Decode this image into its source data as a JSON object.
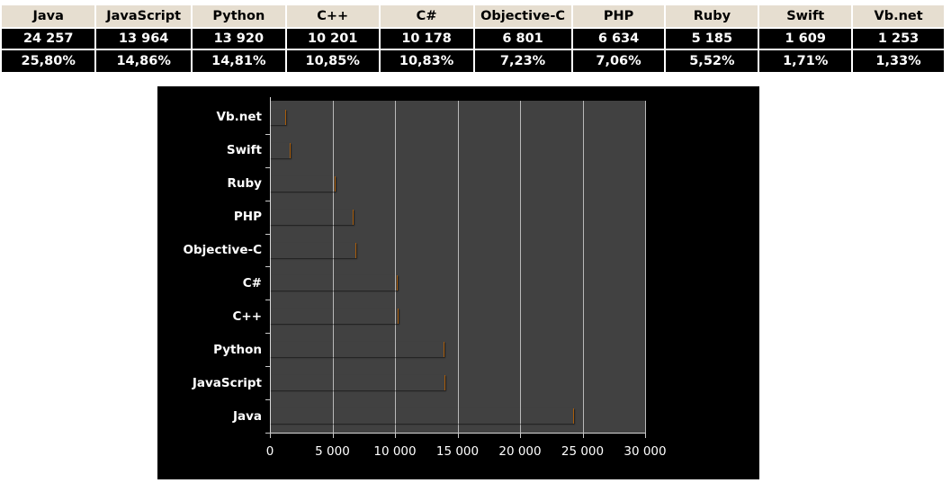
{
  "table": {
    "headers": [
      "Java",
      "JavaScript",
      "Python",
      "C++",
      "C#",
      "Objective-C",
      "PHP",
      "Ruby",
      "Swift",
      "Vb.net"
    ],
    "counts": [
      "24 257",
      "13 964",
      "13 920",
      "10 201",
      "10 178",
      "6 801",
      "6 634",
      "5 185",
      "1 609",
      "1 253"
    ],
    "percents": [
      "25,80%",
      "14,86%",
      "14,81%",
      "10,85%",
      "10,83%",
      "7,23%",
      "7,06%",
      "5,52%",
      "1,71%",
      "1,33%"
    ]
  },
  "chart_data": {
    "type": "bar",
    "orientation": "horizontal",
    "title": "",
    "xlabel": "",
    "ylabel": "",
    "categories": [
      "Java",
      "JavaScript",
      "Python",
      "C++",
      "C#",
      "Objective-C",
      "PHP",
      "Ruby",
      "Swift",
      "Vb.net"
    ],
    "values": [
      24257,
      13964,
      13920,
      10201,
      10178,
      6801,
      6634,
      5185,
      1609,
      1253
    ],
    "xlim": [
      0,
      30000
    ],
    "xticks": [
      0,
      5000,
      10000,
      15000,
      20000,
      25000,
      30000
    ],
    "xtick_labels": [
      "0",
      "5 000",
      "10 000",
      "15 000",
      "20 000",
      "25 000",
      "30 000"
    ],
    "grid": true,
    "legend": false,
    "colors": {
      "bar_light": "#fcd58a",
      "bar_mid": "#f8ad41",
      "bar_dark": "#c87216",
      "plot_background": "#414141",
      "panel_background": "#000000",
      "gridline": "#b9b9b9",
      "text": "#ffffff"
    }
  },
  "styles": {
    "table_header_background": "#e6ded0",
    "table_cell_background": "#000000",
    "table_cell_text": "#ffffff",
    "page_background": "#ffffff"
  }
}
